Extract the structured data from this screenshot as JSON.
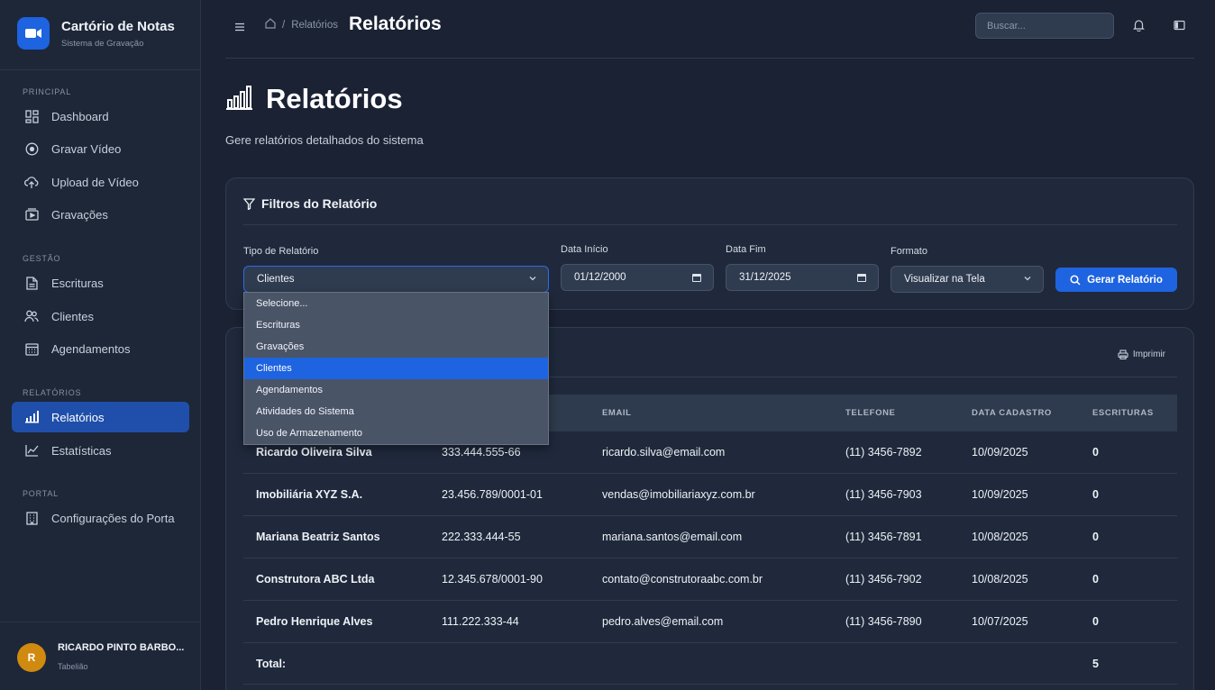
{
  "brand": {
    "title": "Cartório de Notas",
    "subtitle": "Sistema de Gravação"
  },
  "sidebar": {
    "sections": [
      "PRINCIPAL",
      "GESTÃO",
      "RELATÓRIOS",
      "PORTAL"
    ],
    "items": [
      {
        "label": "Dashboard",
        "icon": "dashboard-icon"
      },
      {
        "label": "Gravar Vídeo",
        "icon": "record-icon"
      },
      {
        "label": "Upload de Vídeo",
        "icon": "cloud-upload-icon"
      },
      {
        "label": "Gravações",
        "icon": "video-list-icon"
      },
      {
        "label": "Escrituras",
        "icon": "document-icon"
      },
      {
        "label": "Clientes",
        "icon": "users-icon"
      },
      {
        "label": "Agendamentos",
        "icon": "calendar-icon"
      },
      {
        "label": "Relatórios",
        "icon": "bar-chart-icon",
        "active": true
      },
      {
        "label": "Estatísticas",
        "icon": "line-chart-icon"
      },
      {
        "label": "Configurações do Porta",
        "icon": "building-icon"
      }
    ]
  },
  "user": {
    "initial": "R",
    "name": "RICARDO PINTO BARBO...",
    "role": "Tabelião"
  },
  "topbar": {
    "breadcrumb": "Relatórios",
    "title": "Relatórios",
    "search_placeholder": "Buscar..."
  },
  "page": {
    "title": "Relatórios",
    "subtitle": "Gere relatórios detalhados do sistema"
  },
  "filters": {
    "title": "Filtros do Relatório",
    "type_label": "Tipo de Relatório",
    "type_value": "Clientes",
    "start_label": "Data Início",
    "start_value": "01/12/2000",
    "end_label": "Data Fim",
    "end_value": "31/12/2025",
    "format_label": "Formato",
    "format_value": "Visualizar na Tela",
    "generate_label": "Gerar Relatório",
    "type_options": [
      "Selecione...",
      "Escrituras",
      "Gravações",
      "Clientes",
      "Agendamentos",
      "Atividades do Sistema",
      "Uso de Armazenamento"
    ]
  },
  "results": {
    "print_label": "Imprimir",
    "columns": [
      "EMAIL",
      "TELEFONE",
      "DATA CADASTRO",
      "ESCRITURAS"
    ],
    "rows": [
      {
        "name": "Ricardo Oliveira Silva",
        "doc": "333.444.555-66",
        "email": "ricardo.silva@email.com",
        "phone": "(11) 3456-7892",
        "date": "10/09/2025",
        "deeds": "0"
      },
      {
        "name": "Imobiliária XYZ S.A.",
        "doc": "23.456.789/0001-01",
        "email": "vendas@imobiliariaxyz.com.br",
        "phone": "(11) 3456-7903",
        "date": "10/09/2025",
        "deeds": "0"
      },
      {
        "name": "Mariana Beatriz Santos",
        "doc": "222.333.444-55",
        "email": "mariana.santos@email.com",
        "phone": "(11) 3456-7891",
        "date": "10/08/2025",
        "deeds": "0"
      },
      {
        "name": "Construtora ABC Ltda",
        "doc": "12.345.678/0001-90",
        "email": "contato@construtoraabc.com.br",
        "phone": "(11) 3456-7902",
        "date": "10/08/2025",
        "deeds": "0"
      },
      {
        "name": "Pedro Henrique Alves",
        "doc": "111.222.333-44",
        "email": "pedro.alves@email.com",
        "phone": "(11) 3456-7890",
        "date": "10/07/2025",
        "deeds": "0"
      }
    ],
    "total_label": "Total:",
    "total_value": "5"
  },
  "colors": {
    "accent": "#1e63e0",
    "background": "#1a2233",
    "card": "#1f293b"
  }
}
